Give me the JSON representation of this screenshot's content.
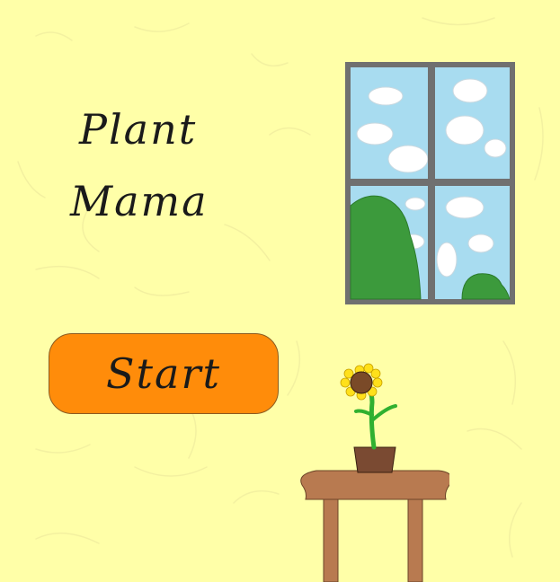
{
  "game": {
    "title_line1": "Plant",
    "title_line2": "Mama",
    "start_button_label": "Start"
  },
  "colors": {
    "wall": "#ffffa8",
    "button": "#ff8c0a",
    "sky": "#a8dcf0",
    "window_frame": "#707070",
    "tree": "#3c9a3c",
    "table": "#b87a50",
    "pot": "#7a4a32",
    "petals": "#ffe01a",
    "flower_center": "#7a4a28",
    "stem": "#30b030"
  },
  "icons": {
    "window": "window-icon",
    "sunflower": "sunflower-icon",
    "table": "side-table-icon"
  }
}
